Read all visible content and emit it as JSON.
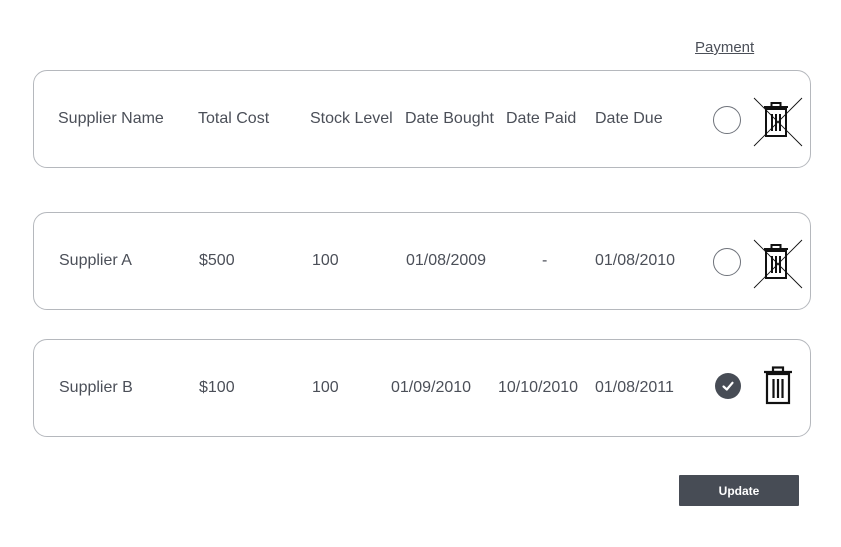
{
  "header": {
    "payment_label": "Payment"
  },
  "columns": {
    "supplier": "Supplier Name",
    "total_cost": "Total Cost",
    "stock_level": "Stock Level",
    "date_bought": "Date Bought",
    "date_paid": "Date Paid",
    "date_due": "Date Due"
  },
  "rows": [
    {
      "supplier": "Supplier A",
      "total_cost": "$500",
      "stock_level": "100",
      "date_bought": "01/08/2009",
      "date_paid": "-",
      "date_due": "01/08/2010",
      "paid": false,
      "delete_disabled": true
    },
    {
      "supplier": "Supplier B",
      "total_cost": "$100",
      "stock_level": "100",
      "date_bought": "01/09/2010",
      "date_paid": "10/10/2010",
      "date_due": "01/08/2011",
      "paid": true,
      "delete_disabled": false
    }
  ],
  "icons": {
    "payment_unchecked": "radio-empty-icon",
    "payment_checked": "check-circle-icon",
    "delete": "trash-icon",
    "delete_disabled": "trash-crossed-icon"
  },
  "colors": {
    "text": "#4b4f58",
    "border": "#b5b8bd",
    "button_bg": "#474c55",
    "button_text": "#ffffff"
  },
  "footer": {
    "update_label": "Update"
  }
}
